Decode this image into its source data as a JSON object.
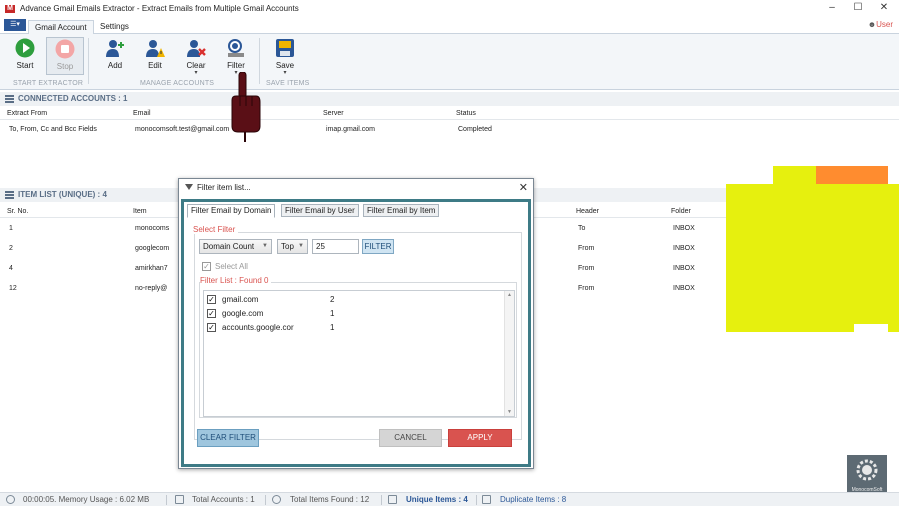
{
  "window": {
    "title": "Advance Gmail Emails Extractor - Extract Emails from Multiple Gmail Accounts",
    "user_label": "User"
  },
  "ribbon": {
    "tabs": [
      "Gmail Account",
      "Settings"
    ],
    "buttons": {
      "start": "Start",
      "stop": "Stop",
      "add": "Add",
      "edit": "Edit",
      "clear": "Clear",
      "filter": "Filter",
      "save": "Save"
    },
    "groups": [
      "START EXTRACTOR",
      "MANAGE ACCOUNTS",
      "SAVE ITEMS"
    ]
  },
  "connected": {
    "title": "CONNECTED ACCOUNTS : 1",
    "columns": [
      "Extract From",
      "Email",
      "Server",
      "Status"
    ],
    "rows": [
      {
        "extract_from": "To, From, Cc and Bcc Fields",
        "email": "monocomsoft.test@gmail.com",
        "server": "imap.gmail.com",
        "status": "Completed"
      }
    ]
  },
  "items": {
    "title": "ITEM LIST (UNIQUE) : 4",
    "columns": [
      "Sr. No.",
      "Item",
      "Header",
      "Folder"
    ],
    "rows": [
      {
        "sr": "1",
        "item": "monocoms",
        "header": "To",
        "folder": "INBOX"
      },
      {
        "sr": "2",
        "item": "googlecom",
        "header": "From",
        "folder": "INBOX"
      },
      {
        "sr": "4",
        "item": "amirkhan7",
        "header": "From",
        "folder": "INBOX"
      },
      {
        "sr": "12",
        "item": "no-reply@",
        "header": "From",
        "folder": "INBOX"
      }
    ]
  },
  "dialog": {
    "title": "Filter item list...",
    "tabs": [
      "Filter Email by Domain",
      "Filter Email by User",
      "Filter Email by Item"
    ],
    "select_filter_title": "Select Filter",
    "sort_by": "Domain Count",
    "order": "Top",
    "count": "25",
    "filter_button": "FILTER",
    "select_all": "Select All",
    "filter_list_title": "Filter List : Found 0",
    "list": [
      {
        "domain": "gmail.com",
        "count": "2",
        "checked": true
      },
      {
        "domain": "google.com",
        "count": "1",
        "checked": true
      },
      {
        "domain": "accounts.google.cor",
        "count": "1",
        "checked": true
      }
    ],
    "clear_filter": "CLEAR FILTER",
    "cancel": "CANCEL",
    "apply": "APPLY",
    "colors": {
      "frame": "#3e7b86",
      "apply": "#d9534f",
      "clear": "#9fc6de"
    }
  },
  "statusbar": {
    "time": "00:00:05. Memory Usage : 6.02 MB",
    "total_accounts": "Total Accounts : 1",
    "total_items": "Total Items Found : 12",
    "unique_items": "Unique Items : 4",
    "duplicate_items": "Duplicate Items : 8"
  },
  "brand": {
    "name": "MonocomSoft"
  }
}
